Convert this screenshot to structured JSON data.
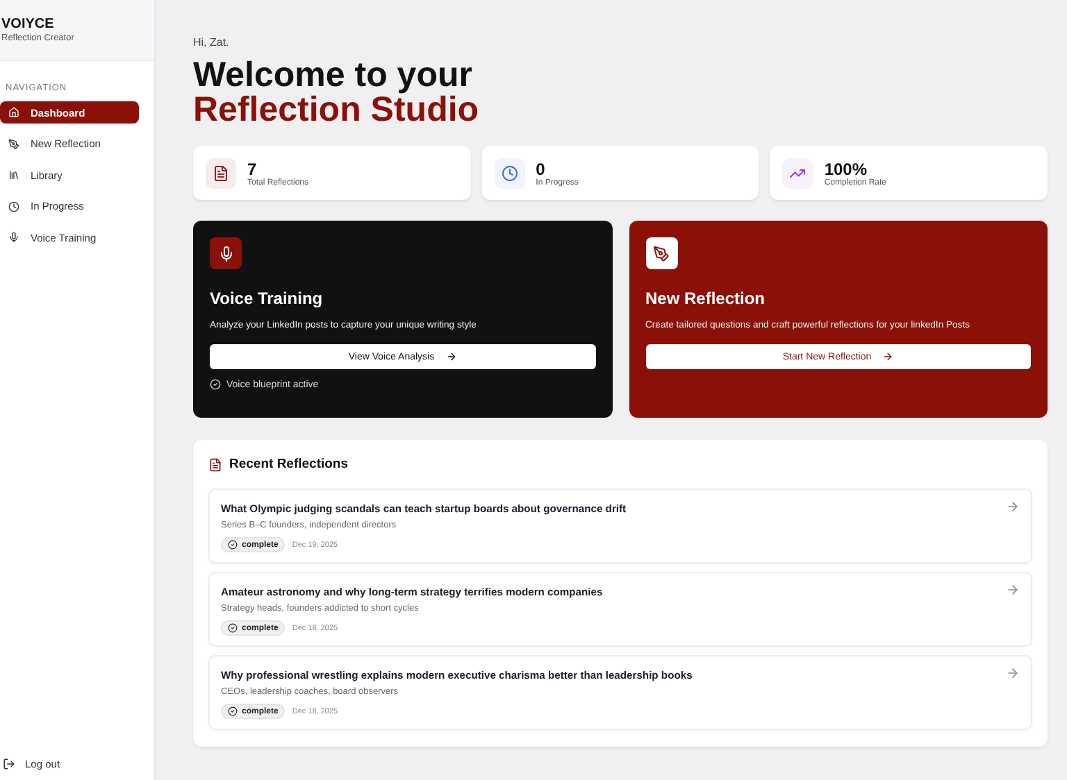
{
  "brand": {
    "name": "VOIYCE",
    "tagline": "Reflection Creator"
  },
  "sidebar": {
    "heading": "NAVIGATION",
    "items": [
      {
        "label": "Dashboard",
        "selected": true
      },
      {
        "label": "New Reflection",
        "selected": false
      },
      {
        "label": "Library",
        "selected": false
      },
      {
        "label": "In Progress",
        "selected": false
      },
      {
        "label": "Voice Training",
        "selected": false
      }
    ],
    "logout": "Log out"
  },
  "greeting": "Hi, Zat.",
  "title": {
    "line1": "Welcome to your",
    "line2": "Reflection Studio"
  },
  "stats": [
    {
      "value": "7",
      "label": "Total Reflections",
      "color": "#9b1c1c"
    },
    {
      "value": "0",
      "label": "In Progress",
      "color": "#3b6fe0"
    },
    {
      "value": "100%",
      "label": "Completion Rate",
      "color": "#9b3be0"
    }
  ],
  "action_cards": [
    {
      "kind": "dark",
      "title": "Voice Training",
      "description": "Analyze your LinkedIn posts to capture your unique writing style",
      "button": "View Voice Analysis",
      "note": "Voice blueprint active"
    },
    {
      "kind": "red",
      "title": "New Reflection",
      "description": "Create tailored questions and craft powerful reflections for your linkedIn Posts",
      "button": "Start New Reflection"
    }
  ],
  "recent": {
    "title": "Recent Reflections",
    "items": [
      {
        "title": "What Olympic judging scandals can teach startup boards about governance drift",
        "audience": "Series B–C founders, independent directors",
        "status": "complete",
        "date": "Dec 19, 2025"
      },
      {
        "title": "Amateur astronomy and why long-term strategy terrifies modern companies",
        "audience": "Strategy heads, founders addicted to short cycles",
        "status": "complete",
        "date": "Dec 18, 2025"
      },
      {
        "title": "Why professional wrestling explains modern executive charisma better than leadership books",
        "audience": "CEOs, leadership coaches, board observers",
        "status": "complete",
        "date": "Dec 18, 2025"
      }
    ]
  }
}
